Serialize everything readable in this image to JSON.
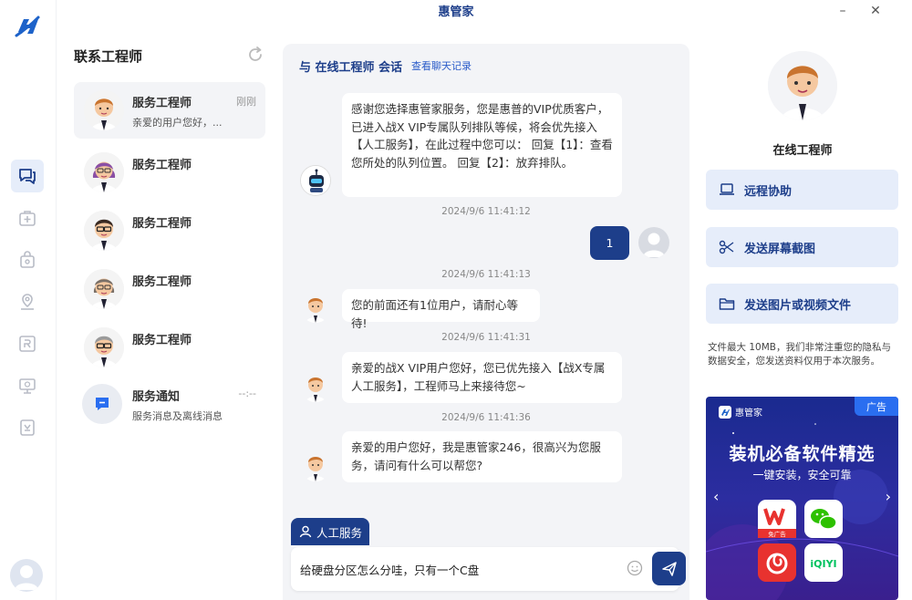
{
  "app": {
    "title": "惠管家"
  },
  "window": {
    "minimize": "–",
    "close": "✕"
  },
  "rail": {
    "items": [
      {
        "name": "chat-icon",
        "active": true
      },
      {
        "name": "medical-kit-icon",
        "active": false
      },
      {
        "name": "bag-icon",
        "active": false
      },
      {
        "name": "location-icon",
        "active": false
      },
      {
        "name": "register-icon",
        "active": false
      },
      {
        "name": "monitor-icon",
        "active": false
      },
      {
        "name": "store-icon",
        "active": false
      }
    ]
  },
  "contacts": {
    "title": "联系工程师",
    "items": [
      {
        "name": "服务工程师",
        "preview": "亲爱的用户您好，...",
        "time": "刚刚",
        "selected": true
      },
      {
        "name": "服务工程师",
        "preview": "",
        "time": ""
      },
      {
        "name": "服务工程师",
        "preview": "",
        "time": ""
      },
      {
        "name": "服务工程师",
        "preview": "",
        "time": ""
      },
      {
        "name": "服务工程师",
        "preview": "",
        "time": ""
      }
    ],
    "notice": {
      "name": "服务通知",
      "preview": "服务消息及离线消息",
      "time": "--:--"
    }
  },
  "chat": {
    "header": "与 在线工程师 会话",
    "history_link": "查看聊天记录",
    "messages": [
      {
        "text": "感谢您选择惠管家服务，您是惠普的VIP优质客户，已进入战X VIP专属队列排队等候，将会优先接入【人工服务】，在此过程中您可以： 回复【1】：查看您所处的队列位置。 回复【2】：放弃排队。"
      },
      {
        "time": "2024/9/6 11:41:12"
      },
      {
        "text": "1",
        "from": "user"
      },
      {
        "time": "2024/9/6 11:41:13"
      },
      {
        "text": "您的前面还有1位用户，请耐心等待!"
      },
      {
        "time": "2024/9/6 11:41:31"
      },
      {
        "text": "亲爱的战X VIP用户您好，您已优先接入【战X专属人工服务】，工程师马上来接待您~"
      },
      {
        "time": "2024/9/6 11:41:36"
      },
      {
        "text": "亲爱的用户您好，我是惠管家246，很高兴为您服务，请问有什么可以帮您?"
      }
    ],
    "manual_service": "人工服务",
    "input_value": "给硬盘分区怎么分哇，只有一个C盘"
  },
  "panel": {
    "engineer_name": "在线工程师",
    "actions": [
      "远程协助",
      "发送屏幕截图",
      "发送图片或视频文件"
    ],
    "file_note": "文件最大 10MB，我们非常注重您的隐私与数据安全，您发送资料仅用于本次服务。",
    "ad": {
      "tag": "广告",
      "brand": "惠管家",
      "title": "装机必备软件精选",
      "subtitle": "一键安装，安全可靠",
      "apps": [
        "W",
        "iQIYI"
      ],
      "app_badge": "免广告"
    }
  },
  "colors": {
    "primary": "#1d3e8a",
    "light": "#e6edfa",
    "chat_bg": "#f3f4f7"
  }
}
